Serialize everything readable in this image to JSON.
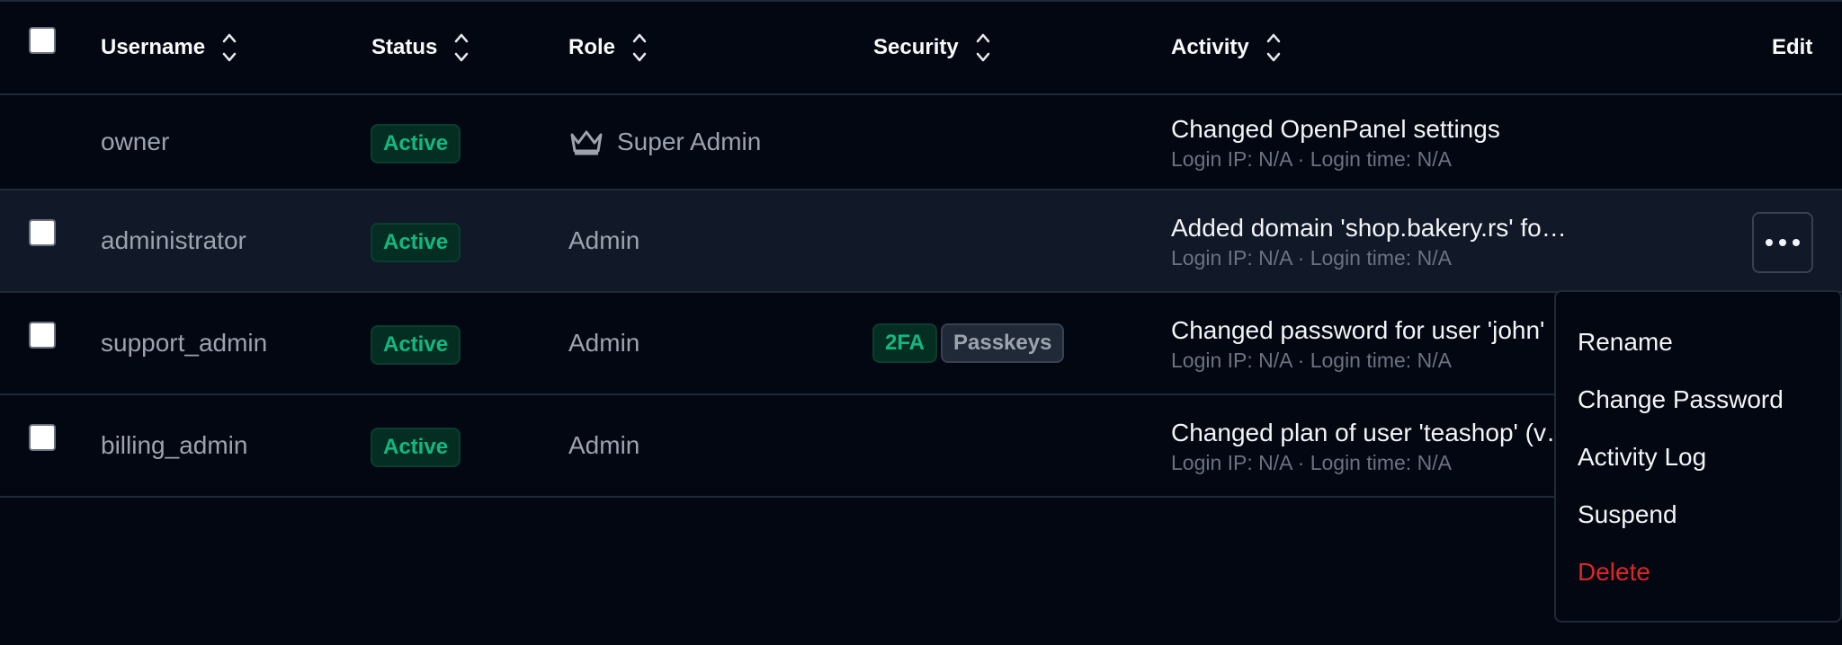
{
  "headers": {
    "username": "Username",
    "status": "Status",
    "role": "Role",
    "security": "Security",
    "activity": "Activity",
    "edit": "Edit"
  },
  "rows": [
    {
      "username": "owner",
      "status": "Active",
      "role": "Super Admin",
      "role_icon": "crown-icon",
      "activity": "Changed OpenPanel settings",
      "login": "Login IP: N/A · Login time: N/A"
    },
    {
      "username": "administrator",
      "status": "Active",
      "role": "Admin",
      "activity": "Added domain 'shop.bakery.rs' fo…",
      "login": "Login IP: N/A · Login time: N/A"
    },
    {
      "username": "support_admin",
      "status": "Active",
      "role": "Admin",
      "security": [
        "2FA",
        "Passkeys"
      ],
      "activity": "Changed password for user 'john'",
      "login": "Login IP: N/A · Login time: N/A"
    },
    {
      "username": "billing_admin",
      "status": "Active",
      "role": "Admin",
      "activity": "Changed plan of user 'teashop' (v…",
      "login": "Login IP: N/A · Login time: N/A"
    }
  ],
  "menu": {
    "items": [
      "Rename",
      "Change Password",
      "Activity Log",
      "Suspend",
      "Delete"
    ]
  },
  "colors": {
    "background": "#030712",
    "active_green": "#10b981",
    "danger_red": "#dc2626",
    "muted": "#9ca3af"
  }
}
